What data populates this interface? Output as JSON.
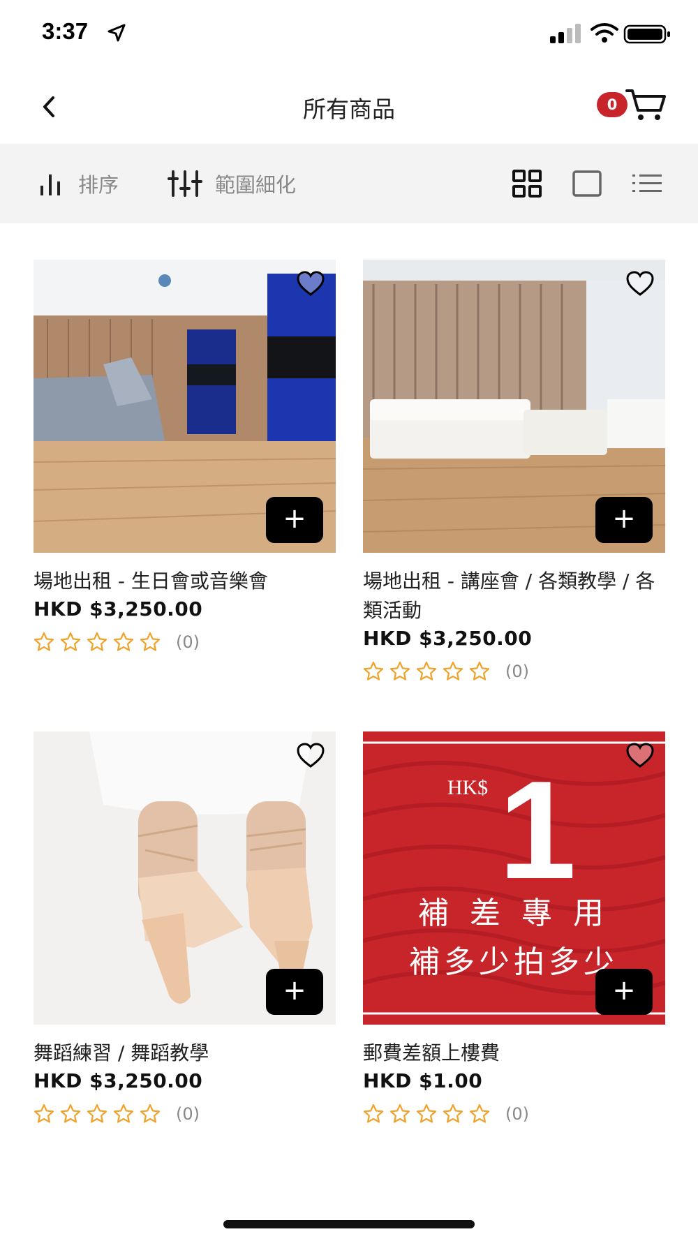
{
  "status_bar": {
    "time": "3:37"
  },
  "header": {
    "title": "所有商品",
    "cart_count": "0"
  },
  "toolbar": {
    "sort_label": "排序",
    "filter_label": "範圍細化"
  },
  "products": [
    {
      "name": "場地出租 - 生日會或音樂會",
      "price": "HKD $3,250.00",
      "rating": 0,
      "review_count": "(0)"
    },
    {
      "name": "場地出租 - 講座會 / 各類教學 / 各類活動",
      "price": "HKD $3,250.00",
      "rating": 0,
      "review_count": "(0)"
    },
    {
      "name": "舞蹈練習 / 舞蹈教學",
      "price": "HKD $3,250.00",
      "rating": 0,
      "review_count": "(0)"
    },
    {
      "name": "郵費差額上樓費",
      "price": "HKD $1.00",
      "rating": 0,
      "review_count": "(0)",
      "image_text": {
        "currency": "HK$",
        "amount": "1",
        "line1": "補 差 專 用",
        "line2": "補多少拍多少"
      }
    }
  ],
  "colors": {
    "accent_red": "#c8252b",
    "star_orange": "#f0a22a",
    "toolbar_bg": "#f3f3f3"
  }
}
